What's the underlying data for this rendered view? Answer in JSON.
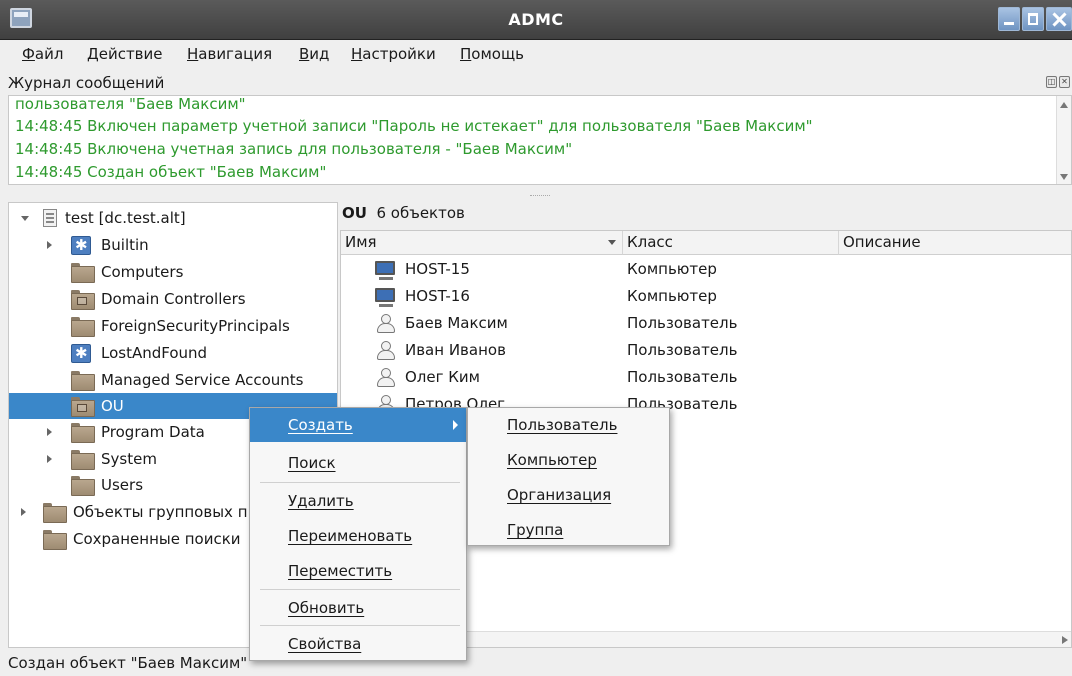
{
  "window": {
    "title": "ADMC"
  },
  "menubar": {
    "items": [
      "Файл",
      "Действие",
      "Навигация",
      "Вид",
      "Настройки",
      "Помощь"
    ]
  },
  "log": {
    "title": "Журнал сообщений",
    "lines": [
      "пользователя \"Баев Максим\"",
      "14:48:45 Включен параметр учетной записи \"Пароль не истекает\" для пользователя \"Баев Максим\"",
      "14:48:45 Включена учетная запись для пользователя - \"Баев Максим\"",
      "14:48:45 Создан объект \"Баев Максим\""
    ],
    "text_color": "#2e9a2e"
  },
  "tree": {
    "items": [
      {
        "label": "test [dc.test.alt]",
        "icon": "domain-icon",
        "expanded": true
      },
      {
        "label": "Builtin",
        "icon": "builtin-icon"
      },
      {
        "label": "Computers",
        "icon": "folder-icon"
      },
      {
        "label": "Domain Controllers",
        "icon": "ou-folder-icon"
      },
      {
        "label": "ForeignSecurityPrincipals",
        "icon": "folder-icon"
      },
      {
        "label": "LostAndFound",
        "icon": "builtin-icon"
      },
      {
        "label": "Managed Service Accounts",
        "icon": "folder-icon"
      },
      {
        "label": "OU",
        "icon": "ou-folder-icon",
        "selected": true
      },
      {
        "label": "Program Data",
        "icon": "folder-icon"
      },
      {
        "label": "System",
        "icon": "folder-icon"
      },
      {
        "label": "Users",
        "icon": "folder-icon"
      },
      {
        "label": "Объекты групповых п",
        "icon": "folder-icon"
      },
      {
        "label": "Сохраненные поиски",
        "icon": "folder-icon"
      }
    ]
  },
  "content": {
    "container_name": "OU",
    "object_count": "6 объектов",
    "columns": [
      "Имя",
      "Класс",
      "Описание"
    ],
    "rows": [
      {
        "name": "HOST-15",
        "class": "Компьютер",
        "icon": "computer-icon"
      },
      {
        "name": "HOST-16",
        "class": "Компьютер",
        "icon": "computer-icon"
      },
      {
        "name": "Баев Максим",
        "class": "Пользователь",
        "icon": "user-icon"
      },
      {
        "name": "Иван Иванов",
        "class": "Пользователь",
        "icon": "user-icon"
      },
      {
        "name": "Олег Ким",
        "class": "Пользователь",
        "icon": "user-icon"
      },
      {
        "name": "Петров Олег",
        "class": "Пользователь",
        "icon": "user-icon"
      }
    ]
  },
  "context_menu": {
    "items": [
      "Создать",
      "Поиск",
      "Удалить",
      "Переименовать",
      "Переместить",
      "Обновить",
      "Свойства"
    ],
    "active": "Создать"
  },
  "submenu": {
    "items": [
      "Пользователь",
      "Компьютер",
      "Организация",
      "Группа"
    ]
  },
  "statusbar": {
    "text": "Создан объект \"Баев Максим\""
  },
  "colors": {
    "selection": "#3a87c9",
    "titlebar": "#4a4a4a"
  }
}
